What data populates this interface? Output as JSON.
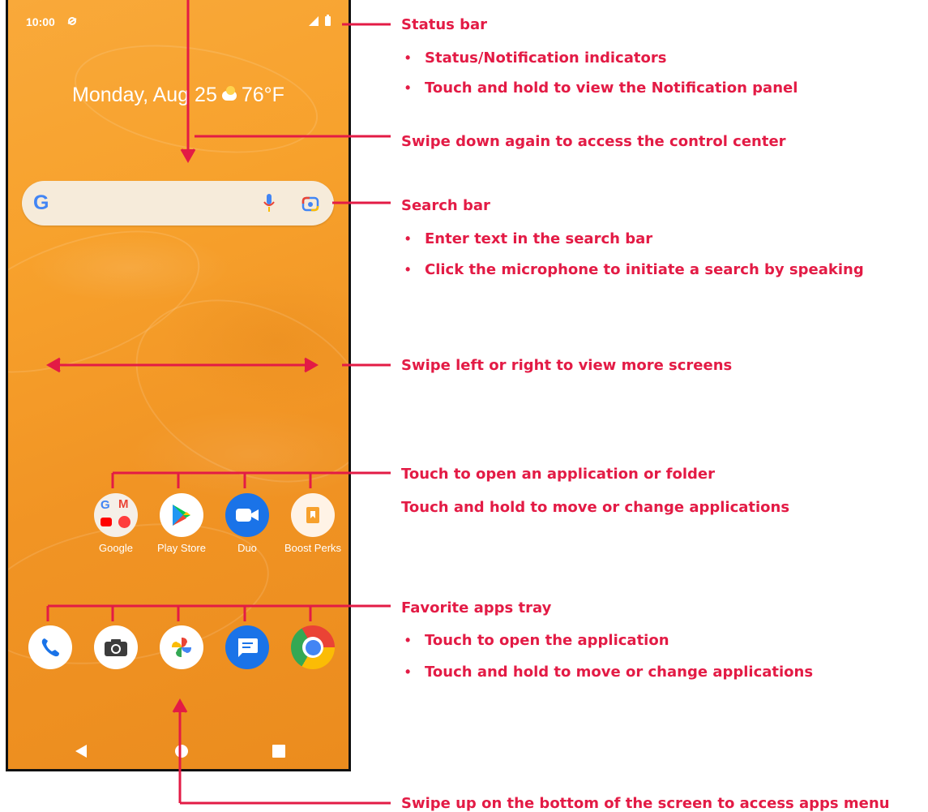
{
  "phone": {
    "status": {
      "time": "10:00"
    },
    "date_text": "Monday, Aug 25",
    "temperature": "76°F",
    "search": {
      "logo": "G",
      "mic_icon": "microphone-icon",
      "lens_icon": "camera-lens-icon"
    },
    "home_apps": [
      {
        "label": "Google",
        "icon": "google-folder-icon"
      },
      {
        "label": "Play Store",
        "icon": "play-store-icon"
      },
      {
        "label": "Duo",
        "icon": "duo-video-icon"
      },
      {
        "label": "Boost Perks",
        "icon": "boost-perks-icon"
      }
    ],
    "tray_apps": [
      {
        "icon": "phone-icon"
      },
      {
        "icon": "camera-icon"
      },
      {
        "icon": "photos-icon"
      },
      {
        "icon": "messages-icon"
      },
      {
        "icon": "chrome-icon"
      }
    ],
    "nav": {
      "back": "back-icon",
      "home": "home-icon",
      "recents": "recents-icon"
    }
  },
  "annotations": {
    "status_bar": {
      "title": "Status bar",
      "bullets": [
        "Status/Notification indicators",
        "Touch and hold to view the Notification panel"
      ]
    },
    "control_center": "Swipe down again to access the control center",
    "search_bar": {
      "title": "Search bar",
      "bullets": [
        "Enter text in the search bar",
        "Click the microphone to initiate a search by speaking"
      ]
    },
    "more_screens": "Swipe left or right to view more screens",
    "apps": {
      "line1": "Touch to open an application or folder",
      "line2": "Touch and hold to move or change applications"
    },
    "favorites": {
      "title": "Favorite apps tray",
      "bullets": [
        "Touch to open the application",
        "Touch and hold to move or change applications"
      ]
    },
    "apps_menu": "Swipe up on the bottom of the screen to access apps menu"
  },
  "colors": {
    "annotation": "#e31b45",
    "wallpaper": "#f7a12c"
  }
}
